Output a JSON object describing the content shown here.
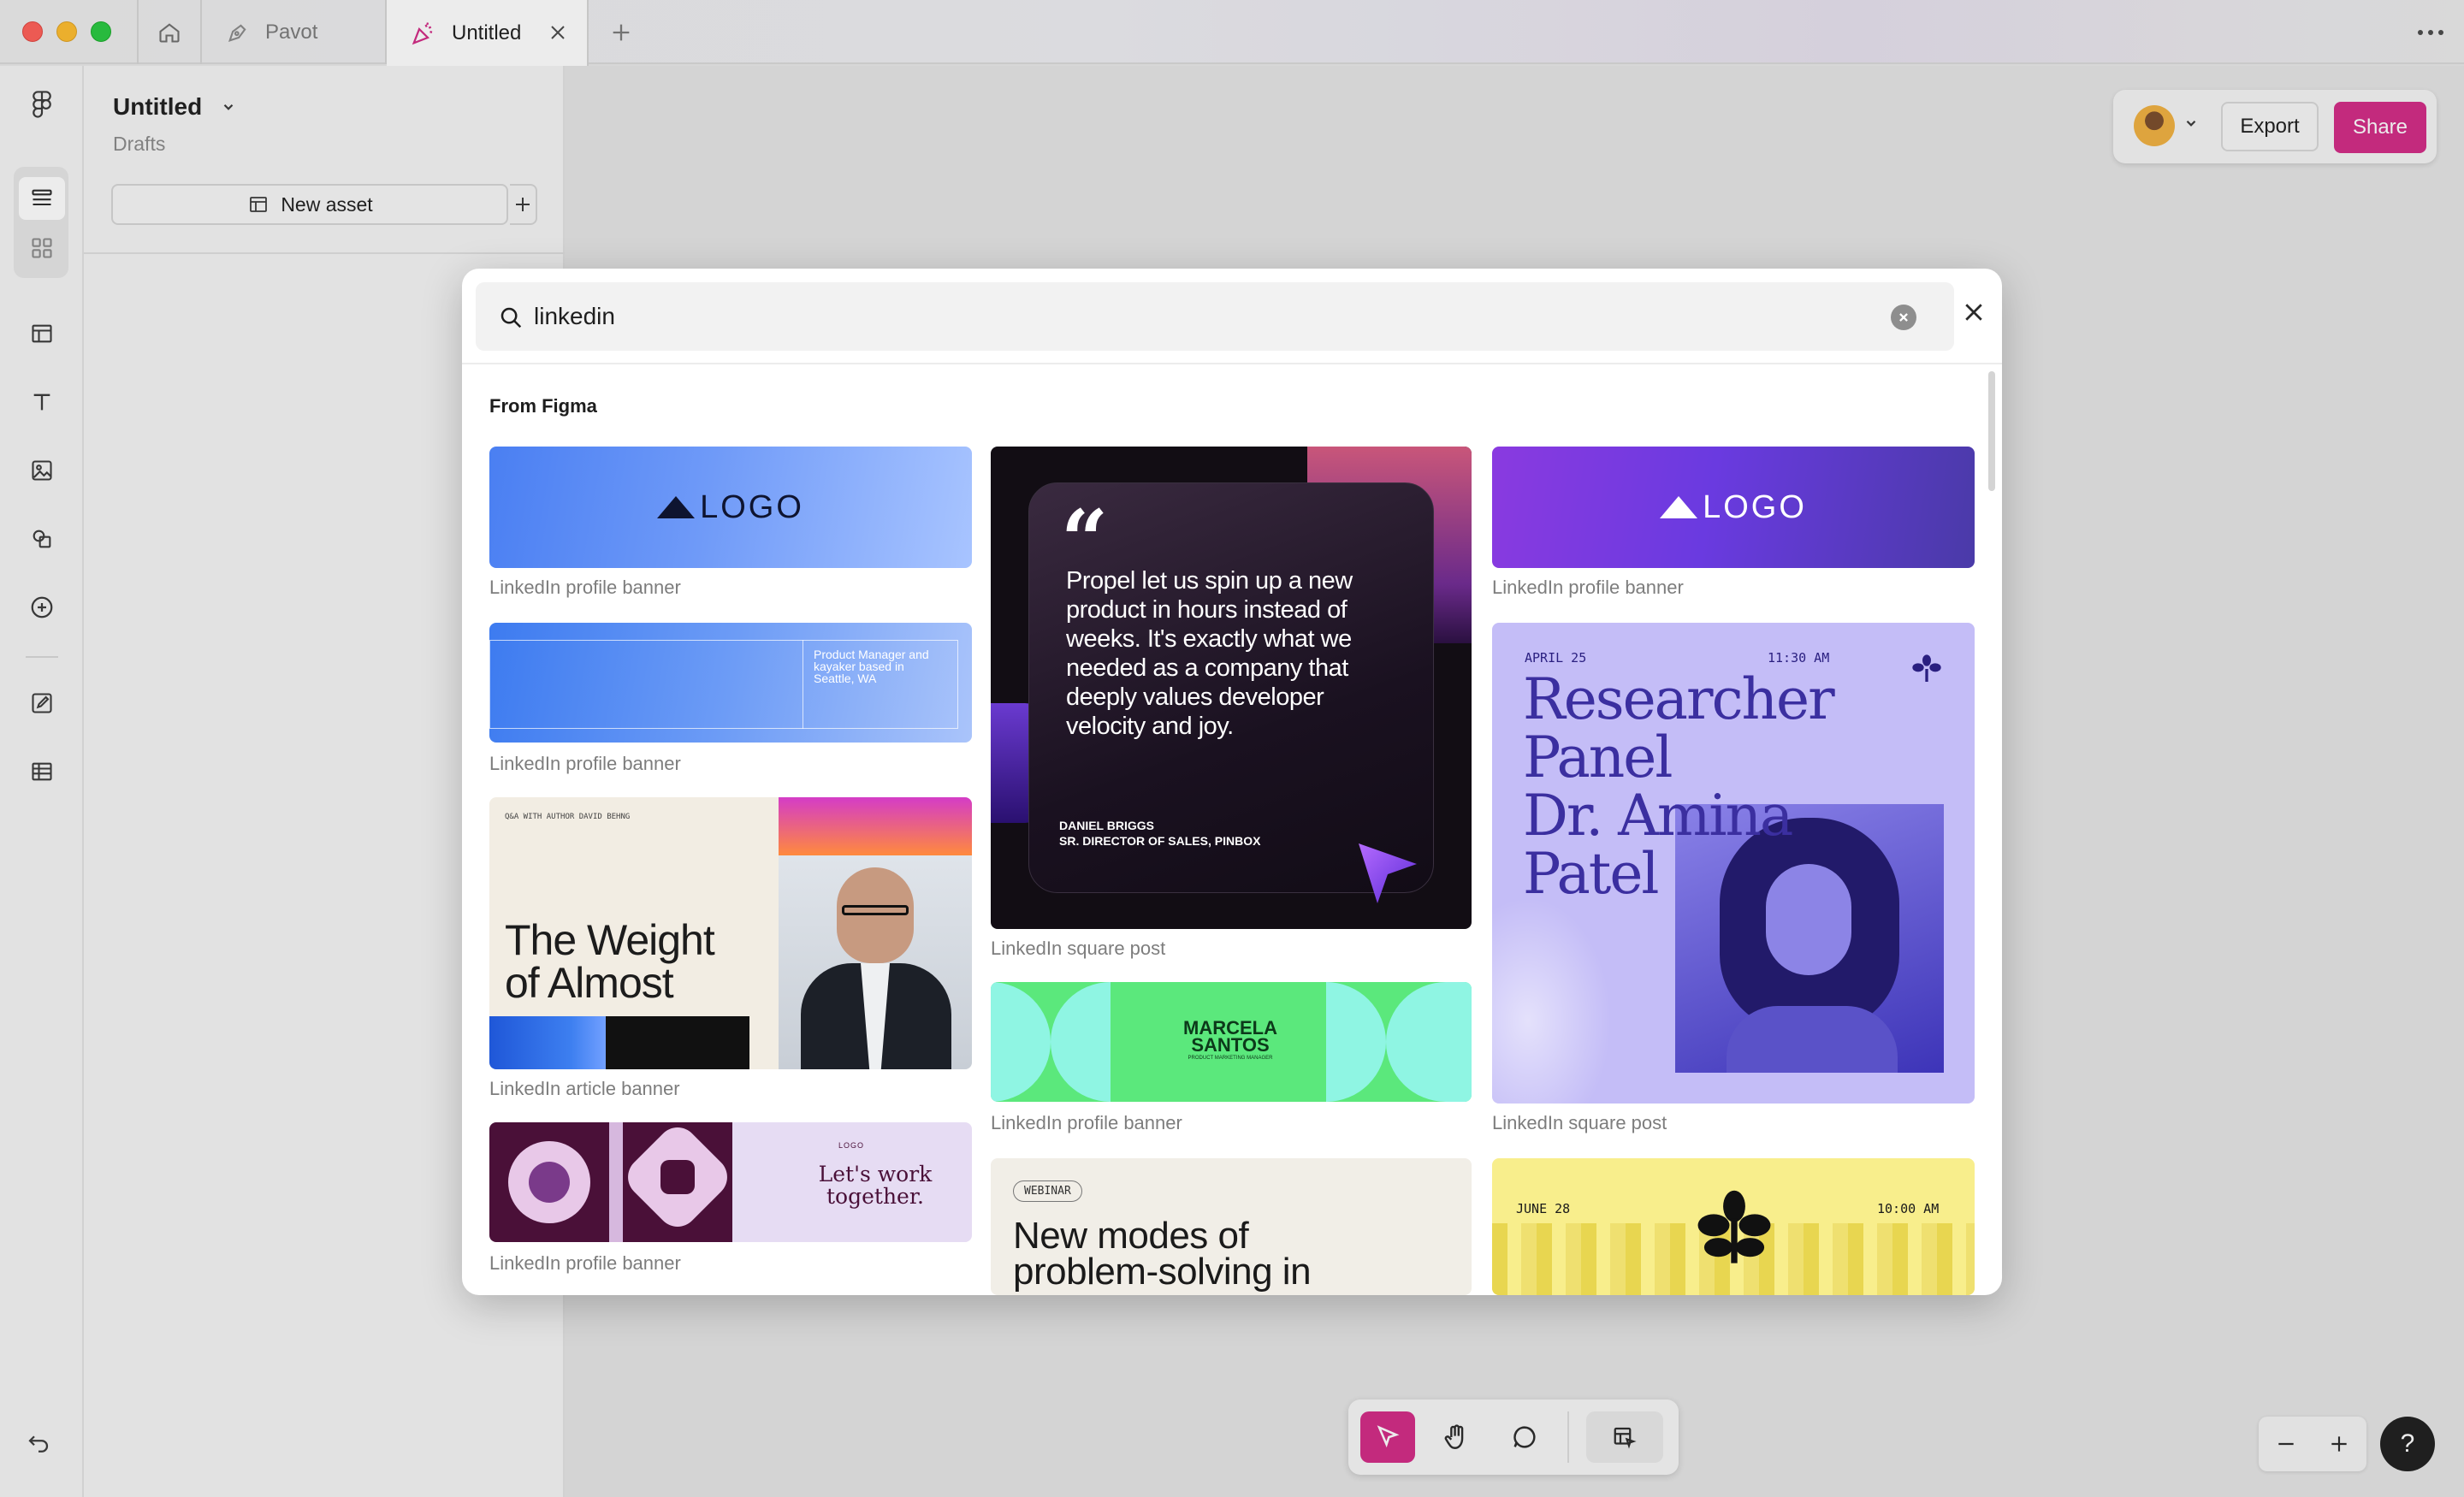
{
  "tabs": {
    "home_icon": "home-icon",
    "items": [
      {
        "label": "Pavot",
        "icon": "pen-nib-icon"
      },
      {
        "label": "Untitled",
        "icon": "party-popper-icon"
      }
    ]
  },
  "file": {
    "title": "Untitled",
    "location": "Drafts",
    "new_asset_label": "New asset"
  },
  "header": {
    "export_label": "Export",
    "share_label": "Share"
  },
  "search": {
    "query": "linkedin",
    "section_title": "From Figma"
  },
  "templates": {
    "col1": [
      {
        "caption": "LinkedIn profile banner",
        "logo_text": "LOGO"
      },
      {
        "caption": "LinkedIn profile banner",
        "bio_text": "Product Manager and kayaker based in Seattle, WA"
      },
      {
        "caption": "LinkedIn article banner",
        "eyebrow": "Q&A WITH AUTHOR DAVID BEHNG",
        "headline_1": "The Weight",
        "headline_2": "of Almost"
      },
      {
        "caption": "LinkedIn profile banner",
        "logo_text": "LOGO",
        "tagline_1": "Let's work",
        "tagline_2": "together."
      }
    ],
    "col2": [
      {
        "caption": "LinkedIn square post",
        "quote_l1": "Propel let us spin up a new",
        "quote_l2": "product in hours instead of",
        "quote_l3": "weeks. It's exactly what we",
        "quote_l4": "needed as a company that",
        "quote_l5": "deeply values developer",
        "quote_l6": "velocity and joy.",
        "author": "DANIEL BRIGGS",
        "role": "SR. DIRECTOR OF SALES, PINBOX"
      },
      {
        "caption": "LinkedIn profile banner",
        "name_1": "MARCELA",
        "name_2": "SANTOS",
        "subtitle": "PRODUCT MARKETING MANAGER"
      },
      {
        "caption": "",
        "badge": "WEBINAR",
        "headline_1": "New modes of",
        "headline_2": "problem-solving in"
      }
    ],
    "col3": [
      {
        "caption": "LinkedIn profile banner",
        "logo_text": "LOGO"
      },
      {
        "caption": "LinkedIn square post",
        "date": "APRIL 25",
        "time": "11:30 AM",
        "h1": "Researcher",
        "h2": "Panel",
        "h3": "Dr. Amina",
        "h4": "Patel"
      },
      {
        "caption": "",
        "date": "JUNE 28",
        "time": "10:00 AM"
      }
    ]
  },
  "colors": {
    "accent": "#d22a86",
    "quote_bg": "#120d14",
    "research_bg": "#c4bdf7",
    "green": "#5be87c",
    "mint": "#8ff5e3",
    "yellow": "#f8ee8c",
    "plum": "#4a1038"
  }
}
